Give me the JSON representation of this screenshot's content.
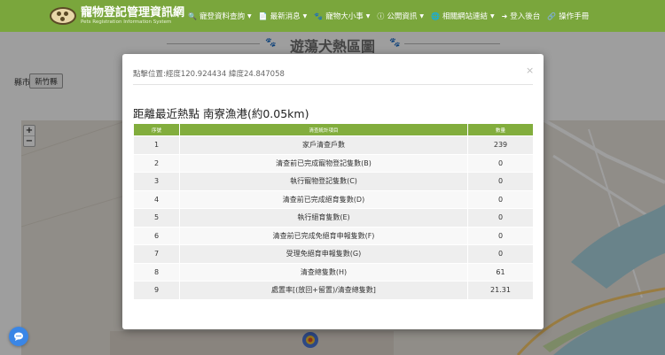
{
  "brand": {
    "title": "寵物登記管理資訊網",
    "subtitle": "Pets Registration Information System"
  },
  "nav": [
    {
      "icon": "search-icon",
      "glyph": "🔍",
      "label": "寵登資料查詢",
      "has_caret": true
    },
    {
      "icon": "document-icon",
      "glyph": "📄",
      "label": "最新消息",
      "has_caret": true
    },
    {
      "icon": "paw-icon",
      "glyph": "🐾",
      "label": "寵物大小事",
      "has_caret": true
    },
    {
      "icon": "info-icon",
      "glyph": "ⓘ",
      "label": "公開資訊",
      "has_caret": true
    },
    {
      "icon": "globe-icon",
      "glyph": "🌐",
      "label": "相關網站連結",
      "has_caret": true
    },
    {
      "icon": "login-icon",
      "glyph": "➜",
      "label": "登入後台",
      "has_caret": false
    },
    {
      "icon": "link-icon",
      "glyph": "🔗",
      "label": "操作手冊",
      "has_caret": false
    }
  ],
  "page": {
    "title": "遊蕩犬熱區圖",
    "county_label": "縣市",
    "county_value": "新竹縣"
  },
  "map": {
    "zoom_in": "+",
    "zoom_out": "−"
  },
  "modal": {
    "coords_text": "點擊位置:經度120.924434 緯度24.847058",
    "close": "×",
    "heading": "距離最近熱點 南寮漁港(約0.05km)",
    "columns": [
      "序號",
      "清查統計項目",
      "數量"
    ],
    "rows": [
      {
        "no": "1",
        "item": "家戶清查戶數",
        "value": "239"
      },
      {
        "no": "2",
        "item": "清查前已完成寵物登記隻數(B)",
        "value": "0"
      },
      {
        "no": "3",
        "item": "執行寵物登記隻數(C)",
        "value": "0"
      },
      {
        "no": "4",
        "item": "清查前已完成絕育隻數(D)",
        "value": "0"
      },
      {
        "no": "5",
        "item": "執行絕育隻數(E)",
        "value": "0"
      },
      {
        "no": "6",
        "item": "清查前已完成免絕育申報隻數(F)",
        "value": "0"
      },
      {
        "no": "7",
        "item": "受理免絕育申報隻數(G)",
        "value": "0"
      },
      {
        "no": "8",
        "item": "清查總隻數(H)",
        "value": "61"
      },
      {
        "no": "9",
        "item": "處置率[(放回+留置)/清查總隻數]",
        "value": "21.31"
      }
    ]
  },
  "colors": {
    "navbar": "#7aa63c",
    "table_header": "#82ad3d",
    "chat_button": "#3a86e6"
  }
}
